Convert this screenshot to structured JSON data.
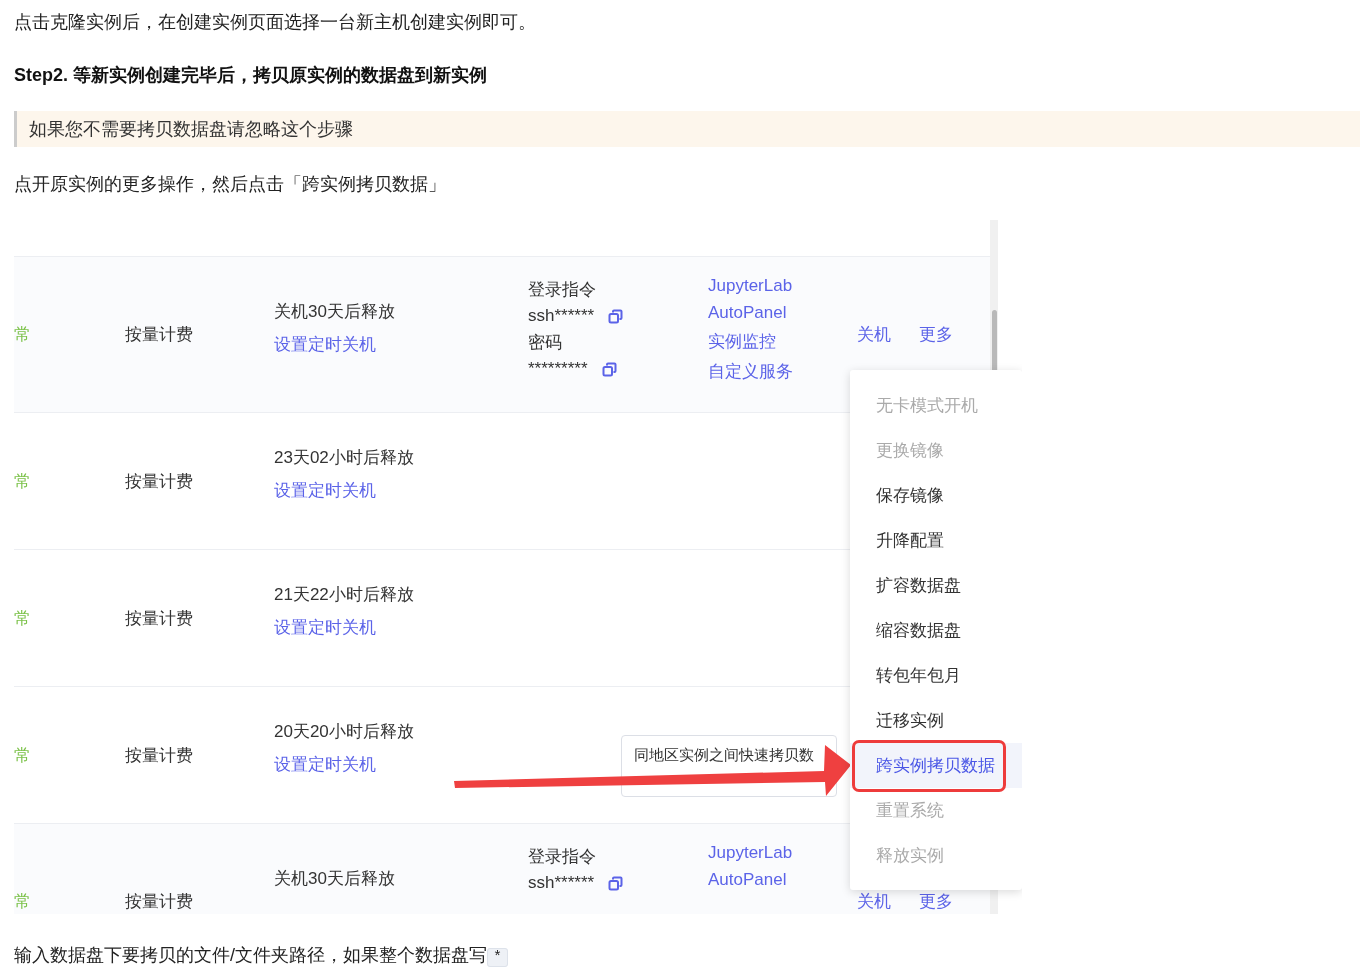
{
  "intro": "点击克隆实例后，在创建实例页面选择一台新主机创建实例即可。",
  "step_heading": "Step2. 等新实例创建完毕后，拷贝原实例的数据盘到新实例",
  "note": "如果您不需要拷贝数据盘请忽略这个步骤",
  "instruction": "点开原实例的更多操作，然后点击「跨实例拷贝数据」",
  "instances": {
    "rows": [
      {
        "highlighted": true,
        "status": "常",
        "billing": "按量计费",
        "release": "关机30天后释放",
        "schedule_link": "设置定时关机",
        "login": {
          "label": "登录指令",
          "command": "ssh******",
          "password_label": "密码",
          "password": "*********"
        },
        "links": [
          "JupyterLab",
          "AutoPanel",
          "实例监控",
          "自定义服务"
        ],
        "actions": [
          "关机",
          "更多"
        ]
      },
      {
        "highlighted": false,
        "status": "常",
        "billing": "按量计费",
        "release": "23天02小时后释放",
        "schedule_link": "设置定时关机"
      },
      {
        "highlighted": false,
        "status": "常",
        "billing": "按量计费",
        "release": "21天22小时后释放",
        "schedule_link": "设置定时关机"
      },
      {
        "highlighted": false,
        "status": "常",
        "billing": "按量计费",
        "release": "20天20小时后释放",
        "schedule_link": "设置定时关机"
      },
      {
        "highlighted": true,
        "status": "常",
        "billing": "按量计费",
        "release": "关机30天后释放",
        "login": {
          "label": "登录指令",
          "command": "ssh******"
        },
        "links": [
          "JupyterLab",
          "AutoPanel"
        ],
        "actions": [
          "关机",
          "更多"
        ]
      }
    ],
    "more_menu": [
      {
        "label": "无卡模式开机",
        "disabled": true,
        "selected": false,
        "annotated": false
      },
      {
        "label": "更换镜像",
        "disabled": true,
        "selected": false,
        "annotated": false
      },
      {
        "label": "保存镜像",
        "disabled": false,
        "selected": false,
        "annotated": false
      },
      {
        "label": "升降配置",
        "disabled": false,
        "selected": false,
        "annotated": false
      },
      {
        "label": "扩容数据盘",
        "disabled": false,
        "selected": false,
        "annotated": false
      },
      {
        "label": "缩容数据盘",
        "disabled": false,
        "selected": false,
        "annotated": false
      },
      {
        "label": "转包年包月",
        "disabled": false,
        "selected": false,
        "annotated": false
      },
      {
        "label": "迁移实例",
        "disabled": false,
        "selected": false,
        "annotated": false
      },
      {
        "label": "跨实例拷贝数据",
        "disabled": false,
        "selected": true,
        "annotated": true
      },
      {
        "label": "重置系统",
        "disabled": true,
        "selected": false,
        "annotated": false
      },
      {
        "label": "释放实例",
        "disabled": true,
        "selected": false,
        "annotated": false
      }
    ],
    "tooltip": "同地区实例之间快速拷贝数"
  },
  "footer": {
    "text": "输入数据盘下要拷贝的文件/文件夹路径，如果整个数据盘写",
    "code": "*"
  }
}
